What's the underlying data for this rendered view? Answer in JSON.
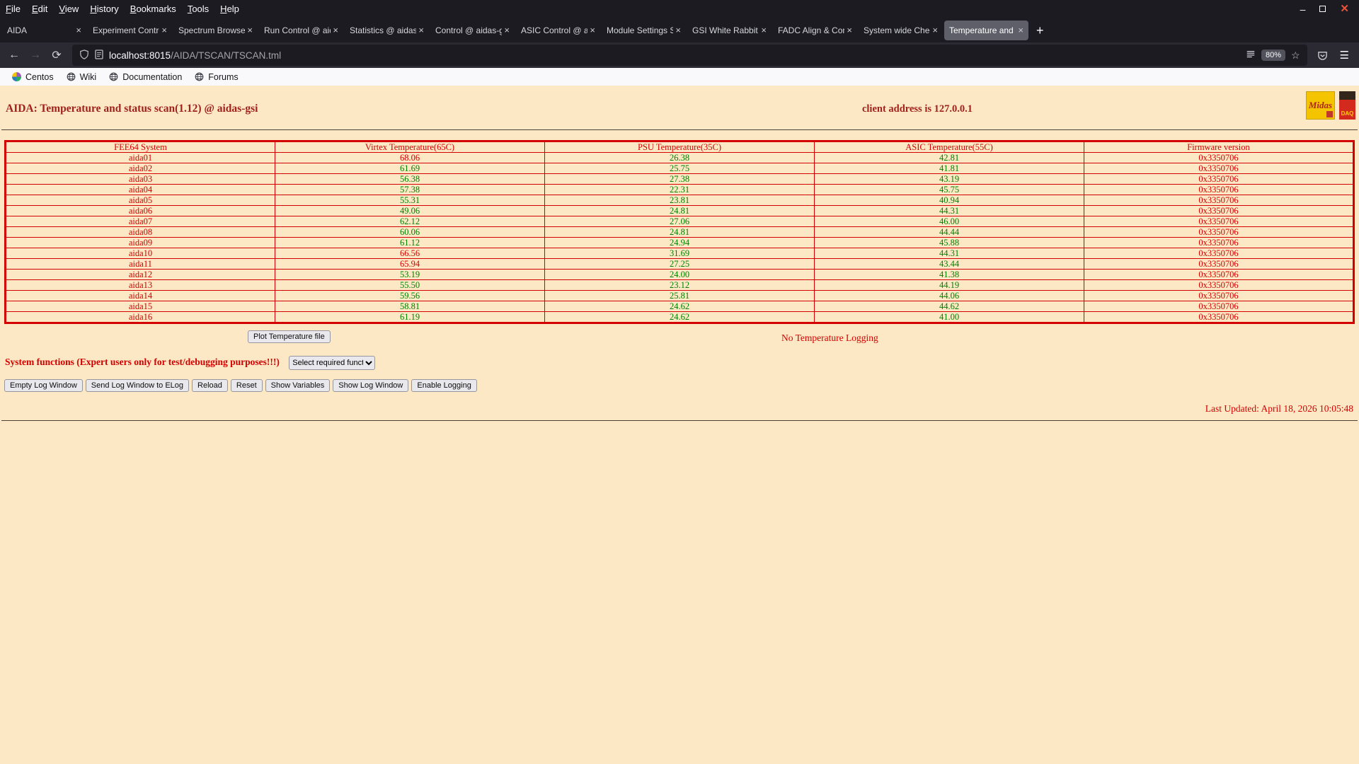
{
  "colors": {
    "page_bg": "#fce8c5",
    "chrome_dark": "#1c1b22",
    "chrome_mid": "#2b2a33",
    "heading_red": "#a0221c",
    "text_red": "#d40000",
    "value_green": "#008000"
  },
  "browser": {
    "menubar": [
      "File",
      "Edit",
      "View",
      "History",
      "Bookmarks",
      "Tools",
      "Help"
    ],
    "window_controls": {
      "minimize": "–",
      "close": "✕"
    },
    "tabs": [
      {
        "label": "AIDA",
        "active": false
      },
      {
        "label": "Experiment Contro",
        "active": false
      },
      {
        "label": "Spectrum Browser",
        "active": false
      },
      {
        "label": "Run Control @ aid",
        "active": false
      },
      {
        "label": "Statistics @ aidas",
        "active": false
      },
      {
        "label": "Control @ aidas-g",
        "active": false
      },
      {
        "label": "ASIC Control @ ai",
        "active": false
      },
      {
        "label": "Module Settings S",
        "active": false
      },
      {
        "label": "GSI White Rabbit T",
        "active": false
      },
      {
        "label": "FADC Align & Cont",
        "active": false
      },
      {
        "label": "System wide Chec",
        "active": false
      },
      {
        "label": "Temperature and s",
        "active": true
      }
    ],
    "new_tab_label": "+",
    "url": {
      "host": "localhost:8015",
      "path": "/AIDA/TSCAN/TSCAN.tml",
      "zoom": "80%"
    },
    "bookmarks": [
      {
        "label": "Centos"
      },
      {
        "label": "Wiki"
      },
      {
        "label": "Documentation"
      },
      {
        "label": "Forums"
      }
    ]
  },
  "page": {
    "title": "AIDA: Temperature and status scan(1.12) @ aidas-gsi",
    "client_address": "client address is 127.0.0.1",
    "logos": {
      "midas_text": "Midas",
      "daq_text": "DAQ"
    },
    "table": {
      "headers": [
        "FEE64 System",
        "Virtex Temperature(65C)",
        "PSU Temperature(35C)",
        "ASIC Temperature(55C)",
        "Firmware version"
      ],
      "limits": {
        "virtex": 65,
        "psu": 35,
        "asic": 55
      },
      "rows": [
        [
          "aida01",
          "68.06",
          "26.38",
          "42.81",
          "0x3350706"
        ],
        [
          "aida02",
          "61.69",
          "25.75",
          "41.81",
          "0x3350706"
        ],
        [
          "aida03",
          "56.38",
          "27.38",
          "43.19",
          "0x3350706"
        ],
        [
          "aida04",
          "57.38",
          "22.31",
          "45.75",
          "0x3350706"
        ],
        [
          "aida05",
          "55.31",
          "23.81",
          "40.94",
          "0x3350706"
        ],
        [
          "aida06",
          "49.06",
          "24.81",
          "44.31",
          "0x3350706"
        ],
        [
          "aida07",
          "62.12",
          "27.06",
          "46.00",
          "0x3350706"
        ],
        [
          "aida08",
          "60.06",
          "24.81",
          "44.44",
          "0x3350706"
        ],
        [
          "aida09",
          "61.12",
          "24.94",
          "45.88",
          "0x3350706"
        ],
        [
          "aida10",
          "66.56",
          "31.69",
          "44.31",
          "0x3350706"
        ],
        [
          "aida11",
          "65.94",
          "27.25",
          "43.44",
          "0x3350706"
        ],
        [
          "aida12",
          "53.19",
          "24.00",
          "41.38",
          "0x3350706"
        ],
        [
          "aida13",
          "55.50",
          "23.12",
          "44.19",
          "0x3350706"
        ],
        [
          "aida14",
          "59.56",
          "25.81",
          "44.06",
          "0x3350706"
        ],
        [
          "aida15",
          "58.81",
          "24.62",
          "44.62",
          "0x3350706"
        ],
        [
          "aida16",
          "61.19",
          "24.62",
          "41.00",
          "0x3350706"
        ]
      ]
    },
    "plot_button": "Plot Temperature file",
    "logging_status": "No Temperature Logging",
    "system_functions_label": "System functions (Expert users only for test/debugging purposes!!!)",
    "select_value": "Select required function",
    "action_buttons": [
      "Empty Log Window",
      "Send Log Window to ELog",
      "Reload",
      "Reset",
      "Show Variables",
      "Show Log Window",
      "Enable Logging"
    ],
    "last_updated": "Last Updated: April 18, 2026 10:05:48"
  }
}
